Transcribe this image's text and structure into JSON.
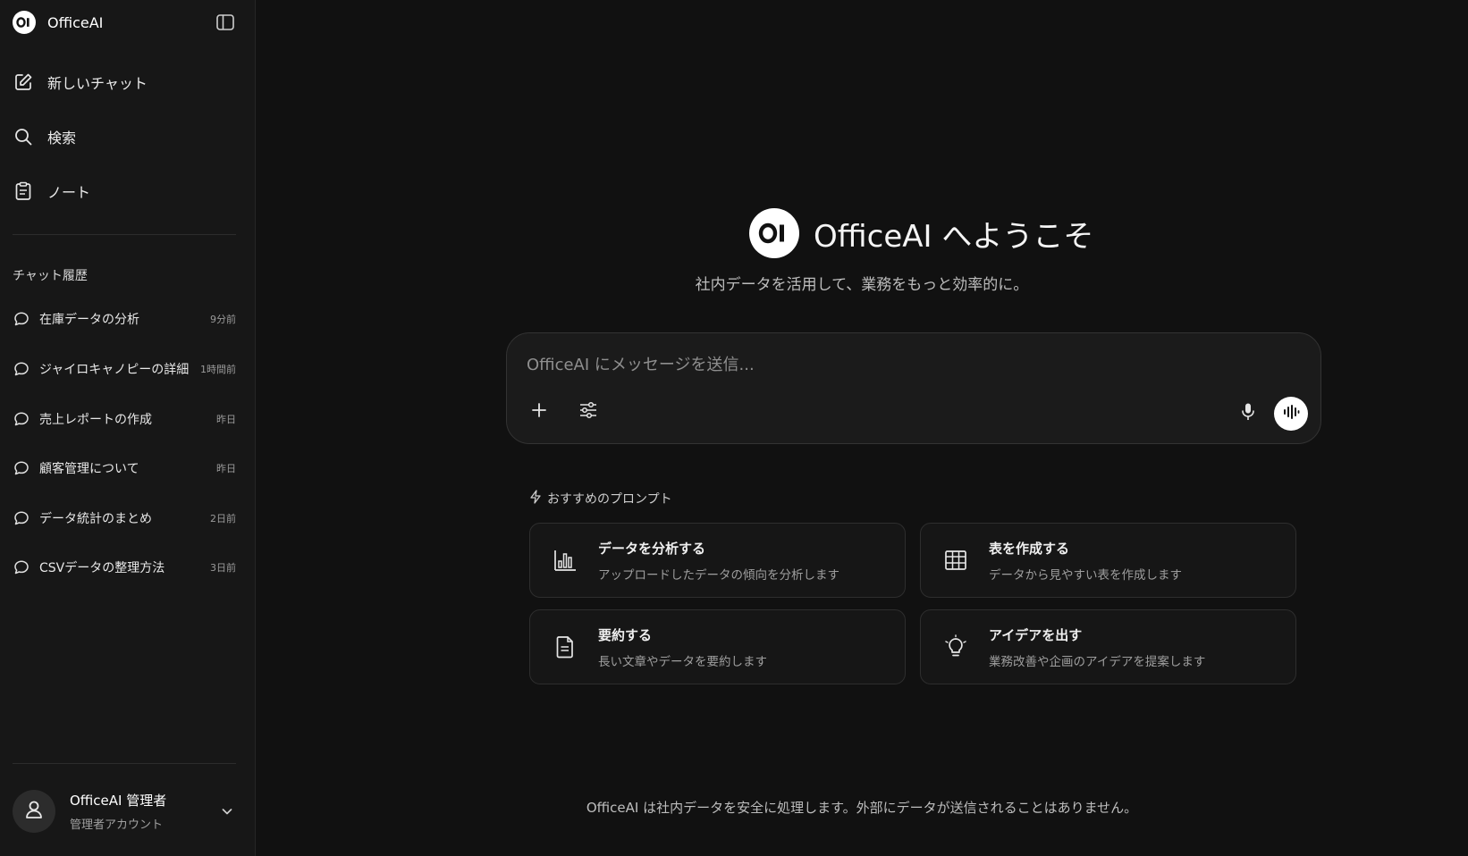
{
  "app": {
    "name": "OfficeAI",
    "logo_text": "OI"
  },
  "sidebar": {
    "nav": [
      {
        "label": "新しいチャット",
        "icon": "edit-icon"
      },
      {
        "label": "検索",
        "icon": "search-icon"
      },
      {
        "label": "ノート",
        "icon": "note-icon"
      }
    ],
    "history_title": "チャット履歴",
    "history": [
      {
        "title": "在庫データの分析",
        "time": "9分前"
      },
      {
        "title": "ジャイロキャノピーの詳細",
        "time": "1時間前"
      },
      {
        "title": "売上レポートの作成",
        "time": "昨日"
      },
      {
        "title": "顧客管理について",
        "time": "昨日"
      },
      {
        "title": "データ統計のまとめ",
        "time": "2日前"
      },
      {
        "title": "CSVデータの整理方法",
        "time": "3日前"
      }
    ],
    "user": {
      "name": "OfficeAI 管理者",
      "role": "管理者アカウント"
    }
  },
  "main": {
    "hero_title": "OfficeAI へようこそ",
    "subtitle": "社内データを活用して、業務をもっと効率的に。",
    "composer": {
      "placeholder": "OfficeAI にメッセージを送信..."
    },
    "recommended_title": "おすすめのプロンプト",
    "cards": [
      {
        "title": "データを分析する",
        "desc": "アップロードしたデータの傾向を分析します",
        "icon": "bar-chart-icon"
      },
      {
        "title": "表を作成する",
        "desc": "データから見やすい表を作成します",
        "icon": "table-icon"
      },
      {
        "title": "要約する",
        "desc": "長い文章やデータを要約します",
        "icon": "document-icon"
      },
      {
        "title": "アイデアを出す",
        "desc": "業務改善や企画のアイデアを提案します",
        "icon": "lightbulb-icon"
      }
    ],
    "footer": "OfficeAI は社内データを安全に処理します。外部にデータが送信されることはありません。"
  },
  "colors": {
    "background": "#111111",
    "sidebar": "#171717",
    "accent": "#ffffff"
  }
}
